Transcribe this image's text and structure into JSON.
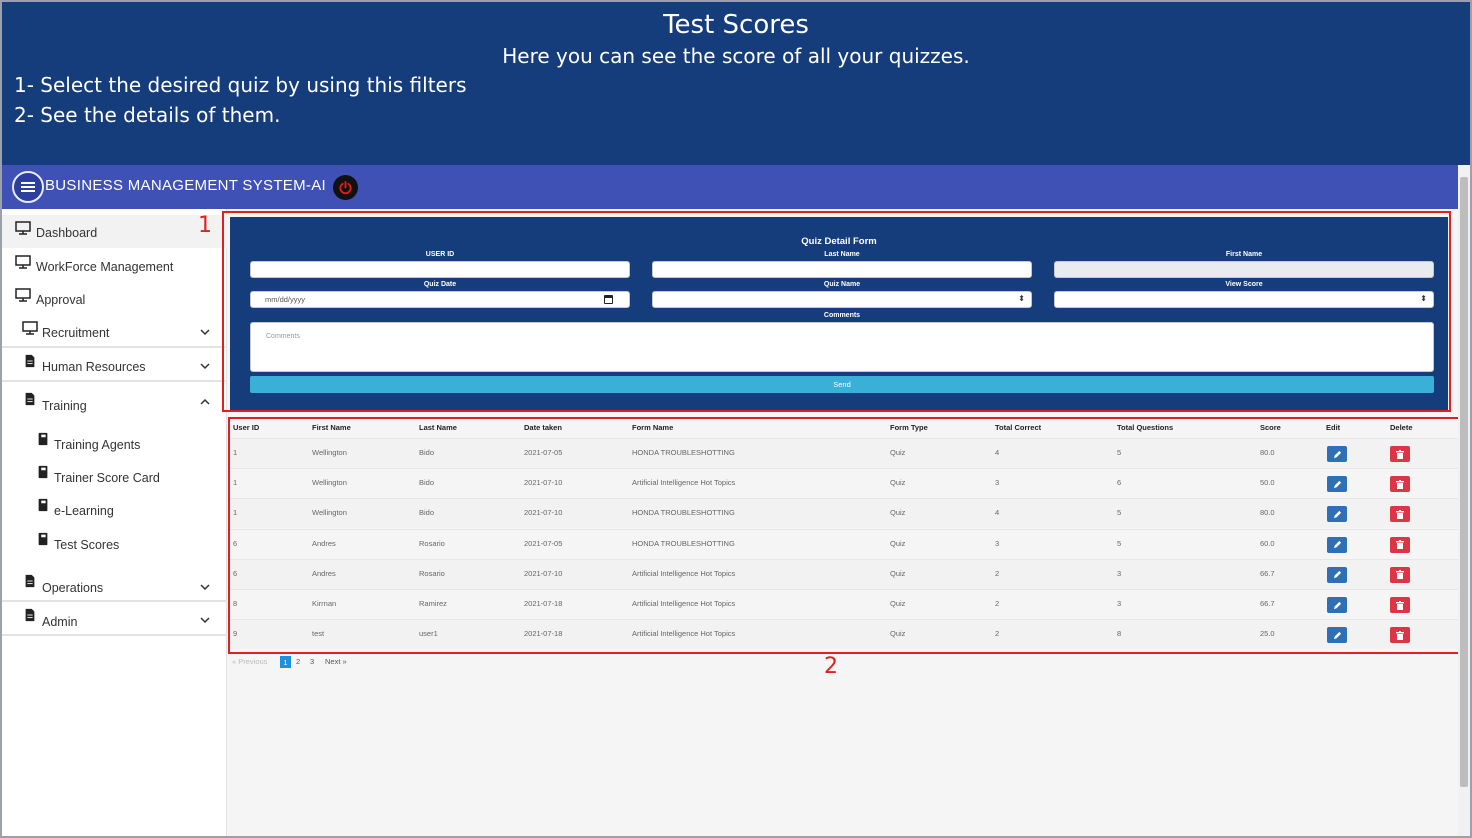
{
  "banner": {
    "title": "Test Scores",
    "subtitle": "Here you can see the score of all your quizzes.",
    "step1": "1- Select the desired quiz by using this filters",
    "step2": "2- See the details of them."
  },
  "header": {
    "app_title": "BUSINESS MANAGEMENT SYSTEM-AI",
    "menu_icon": "hamburger-icon",
    "power_icon": "power-icon"
  },
  "sidebar": {
    "items": [
      {
        "label": "Dashboard",
        "icon": "monitor-icon"
      },
      {
        "label": "WorkForce Management",
        "icon": "monitor-icon"
      },
      {
        "label": "Approval",
        "icon": "monitor-icon"
      },
      {
        "label": "Recruitment",
        "icon": "monitor-icon"
      },
      {
        "label": "Human Resources",
        "icon": "document-icon"
      },
      {
        "label": "Training",
        "icon": "document-icon"
      },
      {
        "label": "Training Agents",
        "icon": "book-icon"
      },
      {
        "label": "Trainer Score Card",
        "icon": "book-icon"
      },
      {
        "label": "e-Learning",
        "icon": "book-icon"
      },
      {
        "label": "Test Scores",
        "icon": "book-icon"
      },
      {
        "label": "Operations",
        "icon": "document-icon"
      },
      {
        "label": "Admin",
        "icon": "document-icon"
      }
    ]
  },
  "form": {
    "title": "Quiz Detail Form",
    "user_id_label": "USER ID",
    "last_name_label": "Last Name",
    "first_name_label": "First Name",
    "quiz_date_label": "Quiz Date",
    "quiz_date_value": "mm/dd/yyyy",
    "quiz_name_label": "Quiz Name",
    "view_score_label": "View Score",
    "comments_label": "Comments",
    "comments_placeholder": "Comments",
    "send_label": "Send"
  },
  "annotations": {
    "box1": "1",
    "box2": "2"
  },
  "table": {
    "headers": [
      "User ID",
      "First Name",
      "Last Name",
      "Date taken",
      "Form Name",
      "Form Type",
      "Total Correct",
      "Total Questions",
      "Score",
      "Edit",
      "Delete"
    ],
    "rows": [
      [
        "1",
        "Wellington",
        "Bido",
        "2021-07-05",
        "HONDA TROUBLESHOTTING",
        "Quiz",
        "4",
        "5",
        "80.0"
      ],
      [
        "1",
        "Wellington",
        "Bido",
        "2021-07-10",
        "Artificial Intelligence Hot Topics",
        "Quiz",
        "3",
        "6",
        "50.0"
      ],
      [
        "1",
        "Wellington",
        "Bido",
        "2021-07-10",
        "HONDA TROUBLESHOTTING",
        "Quiz",
        "4",
        "5",
        "80.0"
      ],
      [
        "6",
        "Andres",
        "Rosario",
        "2021-07-05",
        "HONDA TROUBLESHOTTING",
        "Quiz",
        "3",
        "5",
        "60.0"
      ],
      [
        "6",
        "Andres",
        "Rosario",
        "2021-07-10",
        "Artificial Intelligence Hot Topics",
        "Quiz",
        "2",
        "3",
        "66.7"
      ],
      [
        "8",
        "Kirrnan",
        "Ramirez",
        "2021-07-18",
        "Artificial Intelligence Hot Topics",
        "Quiz",
        "2",
        "3",
        "66.7"
      ],
      [
        "9",
        "test",
        "user1",
        "2021-07-18",
        "Artificial Intelligence Hot Topics",
        "Quiz",
        "2",
        "8",
        "25.0"
      ]
    ]
  },
  "pagination": {
    "previous": "« Previous",
    "pages": [
      "1",
      "2",
      "3"
    ],
    "next": "Next »",
    "current": "1"
  },
  "colors": {
    "banner": "#163d7b",
    "appbar": "#3f51b5",
    "edit": "#2f6fb5",
    "delete": "#dc3545",
    "annotation": "#e02020",
    "send": "#3ab0d8"
  }
}
